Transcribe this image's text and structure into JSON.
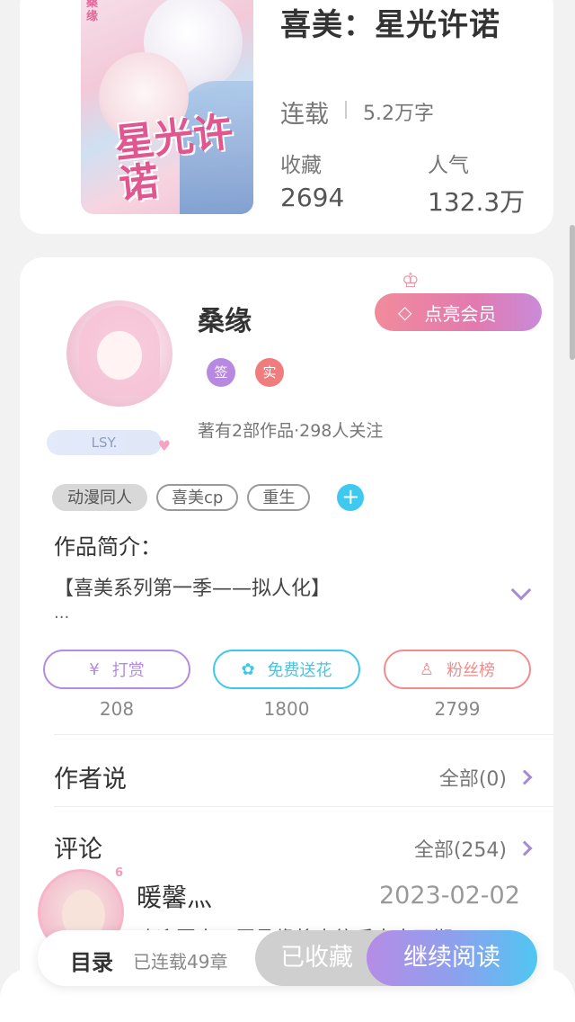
{
  "book": {
    "title": "喜美：星光许诺",
    "cover_title": "星光许诺",
    "cover_side_text": "桑缘",
    "status": "连载",
    "word_count": "5.2万字",
    "favorites_label": "收藏",
    "favorites_value": "2694",
    "popularity_label": "人气",
    "popularity_value": "132.3万"
  },
  "author": {
    "name": "桑缘",
    "nickplate": "LSY.",
    "vip_button": "点亮会员",
    "badges": [
      {
        "label": "签",
        "color": "#b889e0"
      },
      {
        "label": "实",
        "color": "#f07d7d"
      }
    ],
    "meta": "著有2部作品·298人关注"
  },
  "tags": [
    "动漫同人",
    "喜美cp",
    "重生"
  ],
  "intro": {
    "label": "作品简介：",
    "text": "【喜美系列第一季——拟人化】",
    "more": "..."
  },
  "actions": [
    {
      "label": "打赏",
      "icon": "yen-icon",
      "count": "208",
      "color": "#b38be0"
    },
    {
      "label": "免费送花",
      "icon": "flower-icon",
      "count": "1800",
      "color": "#3cc8e8"
    },
    {
      "label": "粉丝榜",
      "icon": "fan-icon",
      "count": "2799",
      "color": "#ef8c8c"
    }
  ],
  "author_says": {
    "title": "作者说",
    "link": "全部(0)"
  },
  "comments": {
    "title": "评论",
    "link": "全部(254)",
    "items": [
      {
        "name": "暖馨灬",
        "date": "2023-02-02",
        "text": "欢迎回来，愿桑缘将来往后未来可期",
        "level": "6"
      }
    ]
  },
  "bottom_bar": {
    "toc": "目录",
    "chapters": "已连载49章",
    "favorited": "已收藏",
    "continue": "继续阅读"
  }
}
